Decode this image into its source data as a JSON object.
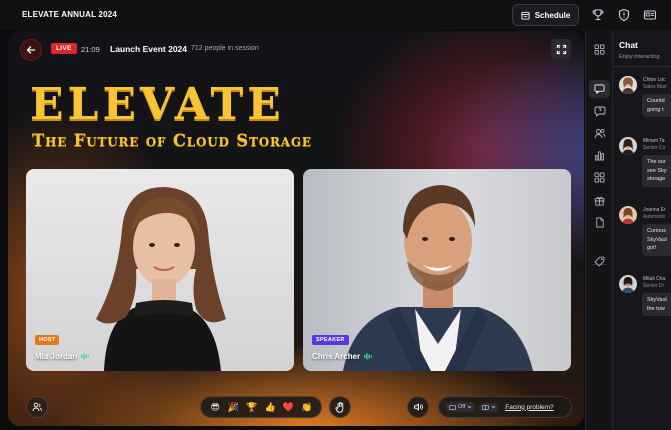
{
  "topbar": {
    "brand": "ELEVATE ANNUAL 2024",
    "schedule_label": "Schedule",
    "icons": [
      "trophy-icon",
      "shield-icon",
      "id-card-icon"
    ]
  },
  "stage": {
    "live_label": "LIVE",
    "time": "21:09",
    "event_title": "Launch Event 2024",
    "attendees": "712 people in session",
    "headline": "ELEVATE",
    "subheadline": "The Future of Cloud Storage"
  },
  "participants": [
    {
      "role": "HOST",
      "name": "Mia Jordan"
    },
    {
      "role": "SPEAKER",
      "name": "Chris Archer"
    }
  ],
  "controls": {
    "reactions": [
      "😎",
      "🎉",
      "🏆",
      "👍",
      "❤️",
      "👏"
    ],
    "camera_state": "Off",
    "facing_problem": "Facing problem?"
  },
  "chat": {
    "title": "Chat",
    "subtitle": "Enjoy interacting",
    "messages": [
      {
        "name": "Chloe Loc",
        "role": "Sales Man",
        "lines": [
          "Countd",
          "going t"
        ]
      },
      {
        "name": "Miriam Ta",
        "role": "Senior Co",
        "lines": [
          "The sur",
          "see Sky",
          "storage"
        ]
      },
      {
        "name": "Joanna Er",
        "role": "Automotiv",
        "lines": [
          "Curious",
          "SkyVaul",
          "got!"
        ]
      },
      {
        "name": "Mitali Cha",
        "role": "Senior Di",
        "lines": [
          "SkyVaul",
          "the tow"
        ]
      }
    ]
  },
  "colors": {
    "accent_gold": "#f6c435",
    "live_red": "#e0262a",
    "host_orange": "#e07a20",
    "speaker_purple": "#5b3bd8",
    "speaking_green": "#3ddc84"
  }
}
